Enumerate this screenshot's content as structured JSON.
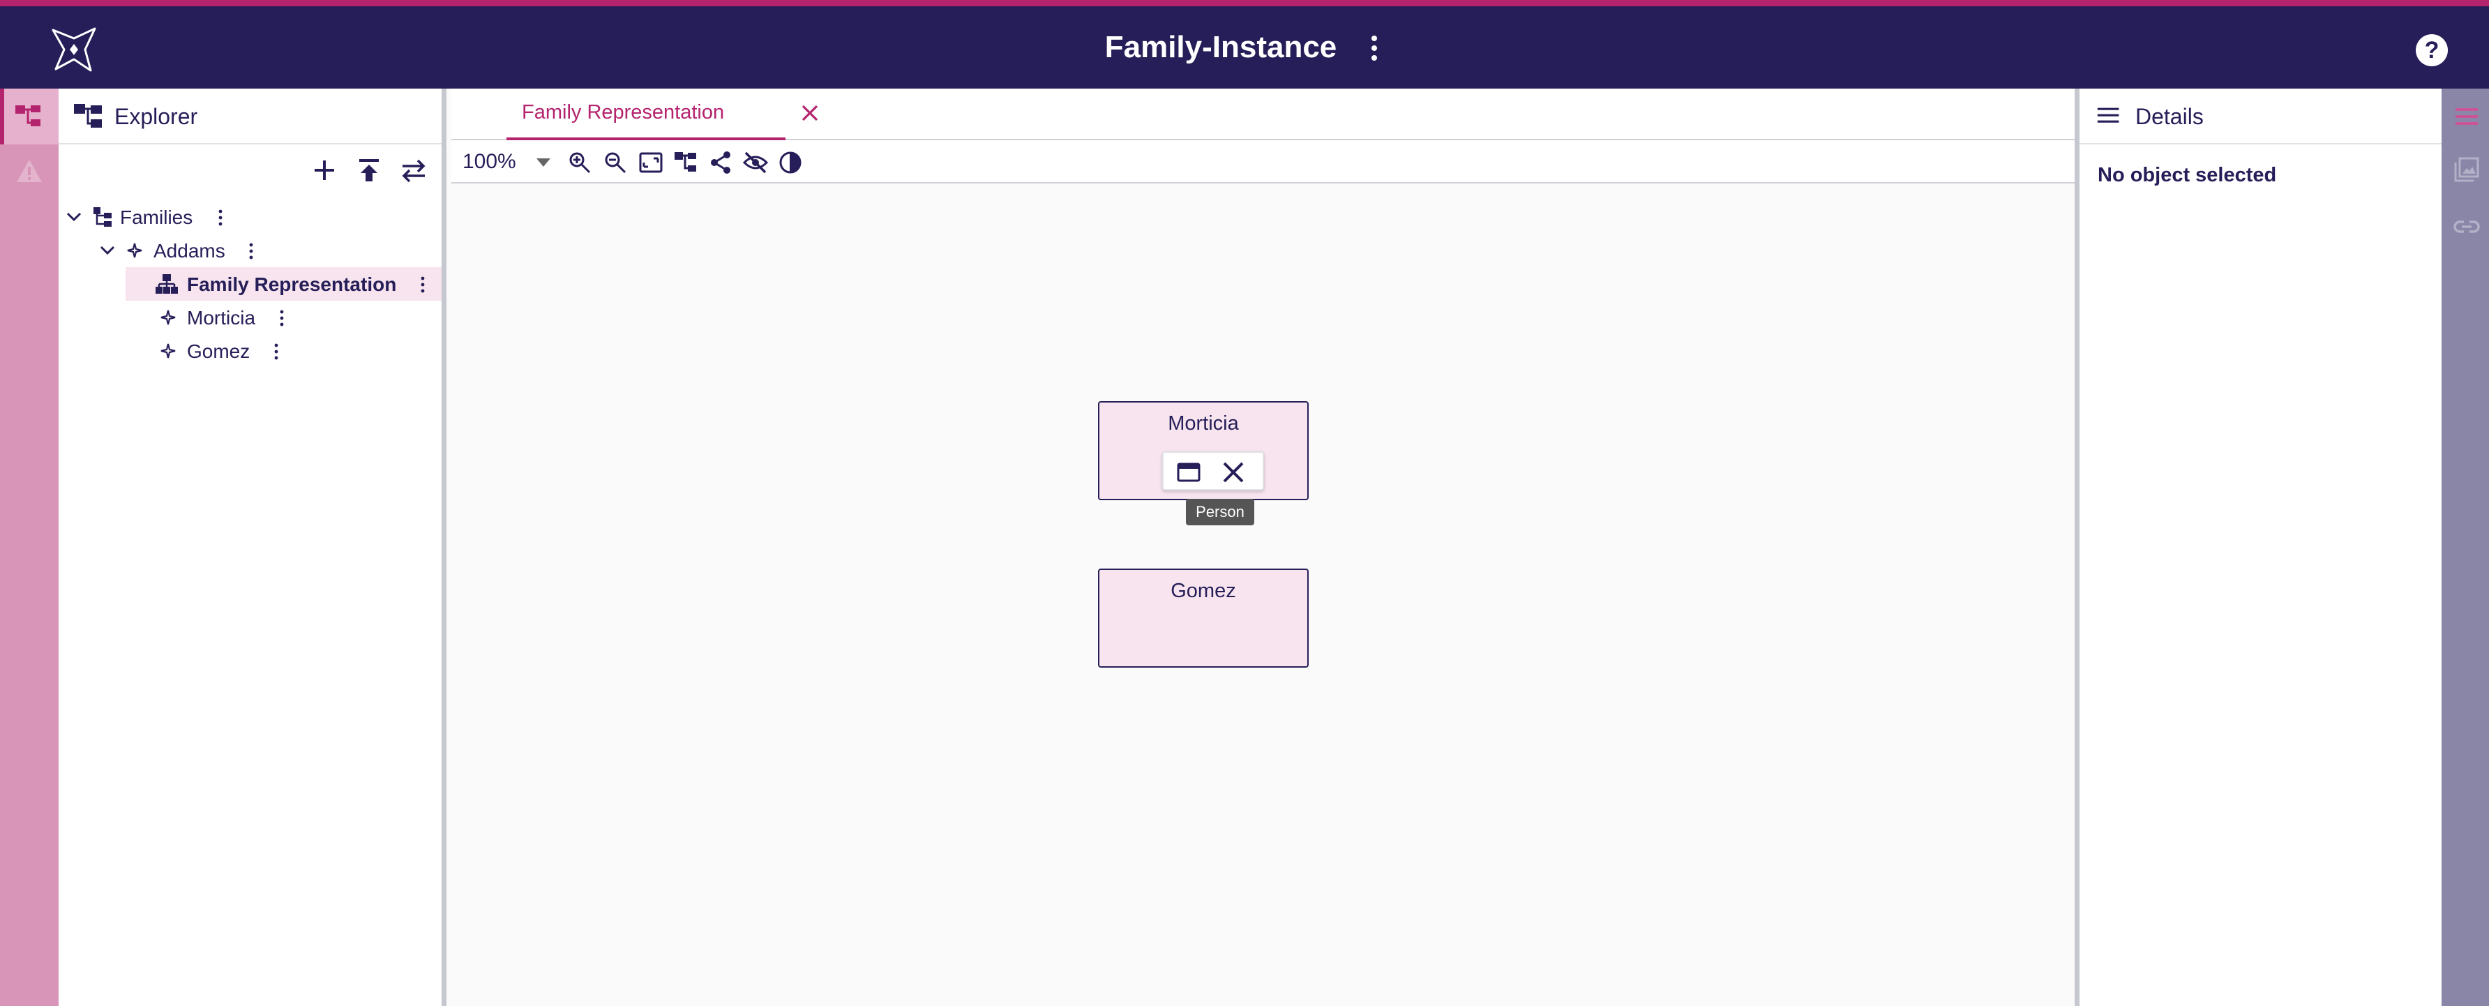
{
  "header": {
    "title": "Family-Instance",
    "help_glyph": "?"
  },
  "explorer": {
    "title": "Explorer",
    "tree": [
      {
        "label": "Families",
        "icon": "tree-icon",
        "level": 0,
        "expanded": true
      },
      {
        "label": "Addams",
        "icon": "sparkle-icon",
        "level": 1,
        "expanded": true
      },
      {
        "label": "Family Representation",
        "icon": "diagram-icon",
        "level": 2,
        "selected": true
      },
      {
        "label": "Morticia",
        "icon": "sparkle-icon",
        "level": 2
      },
      {
        "label": "Gomez",
        "icon": "sparkle-icon",
        "level": 2
      }
    ]
  },
  "editor": {
    "tab_label": "Family Representation",
    "zoom": "100%",
    "nodes": [
      {
        "label": "Morticia"
      },
      {
        "label": "Gomez"
      }
    ],
    "tooltip": "Person"
  },
  "details": {
    "title": "Details",
    "empty_message": "No object selected"
  },
  "colors": {
    "header": "#261e58",
    "accent": "#b4236e",
    "node_fill": "#f7e4ee",
    "left_rail": "#d895b8",
    "right_rail": "#8a86a8"
  }
}
